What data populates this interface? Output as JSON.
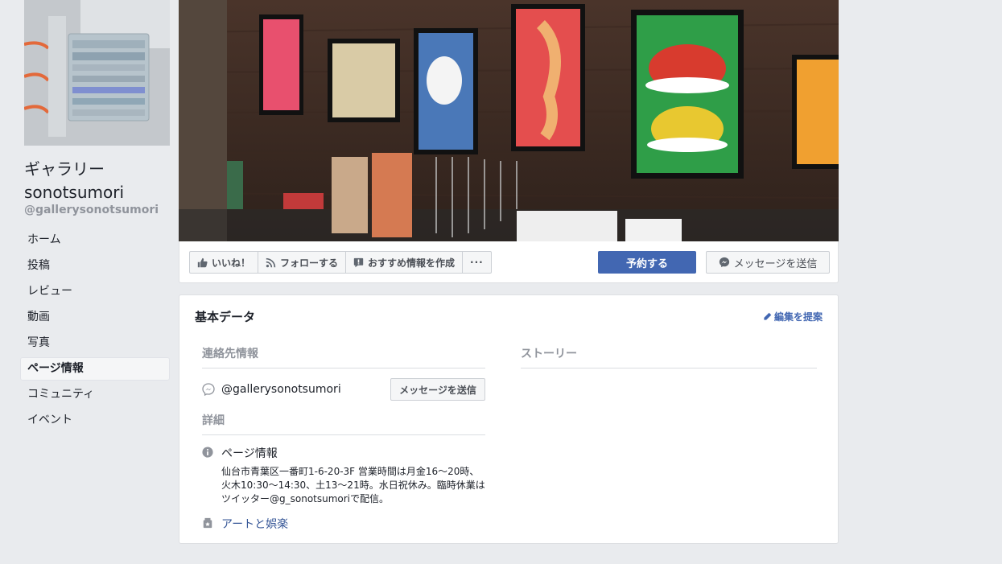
{
  "page": {
    "name": "ギャラリー\nsonotsumori",
    "name_line1": "ギャラリー",
    "name_line2": "sonotsumori",
    "handle": "@gallerysonotsumori"
  },
  "sidebar": {
    "items": [
      {
        "label": "ホーム",
        "active": false
      },
      {
        "label": "投稿",
        "active": false
      },
      {
        "label": "レビュー",
        "active": false
      },
      {
        "label": "動画",
        "active": false
      },
      {
        "label": "写真",
        "active": false
      },
      {
        "label": "ページ情報",
        "active": true
      },
      {
        "label": "コミュニティ",
        "active": false
      },
      {
        "label": "イベント",
        "active": false
      }
    ]
  },
  "actions": {
    "like": "いいね！",
    "follow": "フォローする",
    "recommend": "おすすめ情報を作成",
    "more": "···",
    "book": "予約する",
    "message": "メッセージを送信"
  },
  "about": {
    "title": "基本データ",
    "suggest_edit": "編集を提案",
    "contact_head": "連絡先情報",
    "contact_handle": "@gallerysonotsumori",
    "contact_message_btn": "メッセージを送信",
    "details_head": "詳細",
    "page_info_title": "ページ情報",
    "page_info_body": "仙台市青葉区一番町1-6-20-3F 営業時間は月金16～20時、火木10:30～14:30、土13～21時。水日祝休み。臨時休業はツイッター@g_sonotsumoriで配信。",
    "category": "アートと娯楽",
    "story_head": "ストーリー"
  },
  "colors": {
    "accent": "#4267b2",
    "link": "#385898",
    "background": "#e9ebee"
  },
  "icons": {
    "like": "thumbs-up-icon",
    "follow": "rss-icon",
    "recommend": "speech-bubble-icon",
    "messenger": "messenger-icon",
    "info": "info-icon",
    "category": "category-icon",
    "edit": "pencil-icon"
  }
}
